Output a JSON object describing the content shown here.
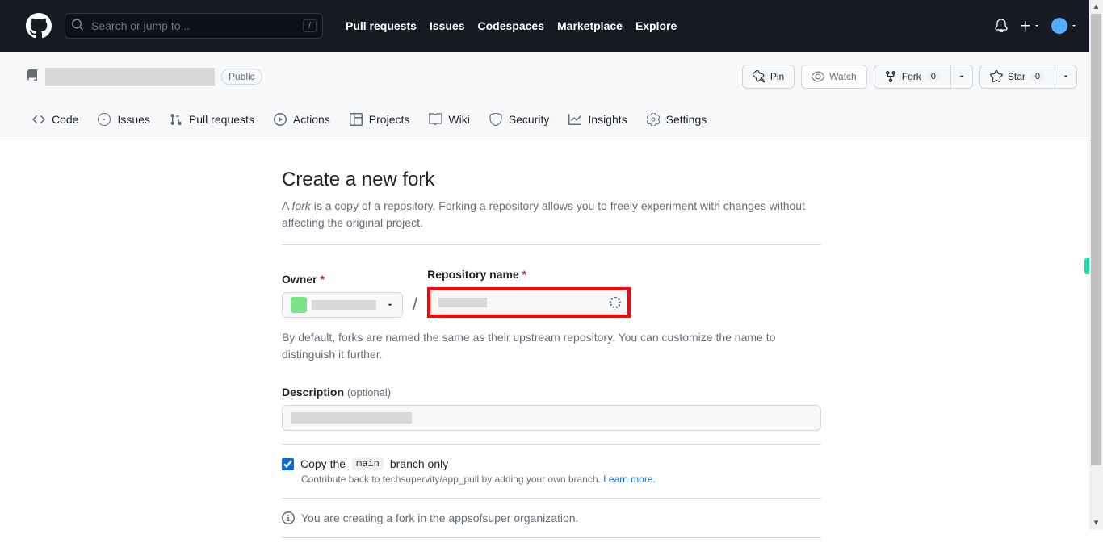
{
  "header": {
    "search_placeholder": "Search or jump to...",
    "slash": "/",
    "nav": {
      "pull_requests": "Pull requests",
      "issues": "Issues",
      "codespaces": "Codespaces",
      "marketplace": "Marketplace",
      "explore": "Explore"
    }
  },
  "repo": {
    "public_label": "Public",
    "actions": {
      "pin": "Pin",
      "watch": "Watch",
      "fork": "Fork",
      "fork_count": "0",
      "star": "Star",
      "star_count": "0"
    },
    "tabs": {
      "code": "Code",
      "issues": "Issues",
      "pull_requests": "Pull requests",
      "actions": "Actions",
      "projects": "Projects",
      "wiki": "Wiki",
      "security": "Security",
      "insights": "Insights",
      "settings": "Settings"
    }
  },
  "form": {
    "title": "Create a new fork",
    "desc_prefix": "A ",
    "desc_em": "fork",
    "desc_suffix": " is a copy of a repository. Forking a repository allows you to freely experiment with changes without affecting the original project.",
    "owner_label": "Owner",
    "reponame_label": "Repository name",
    "helper1": "By default, forks are named the same as their upstream repository. You can customize the name to distinguish it further.",
    "desc_label": "Description",
    "optional": "(optional)",
    "copy_prefix": "Copy the ",
    "branch": "main",
    "copy_suffix": " branch only",
    "copy_helper_prefix": "Contribute back to techsupervity/app_pull by adding your own branch. ",
    "learn_more": "Learn more.",
    "info_text": "You are creating a fork in the appsofsuper organization."
  }
}
